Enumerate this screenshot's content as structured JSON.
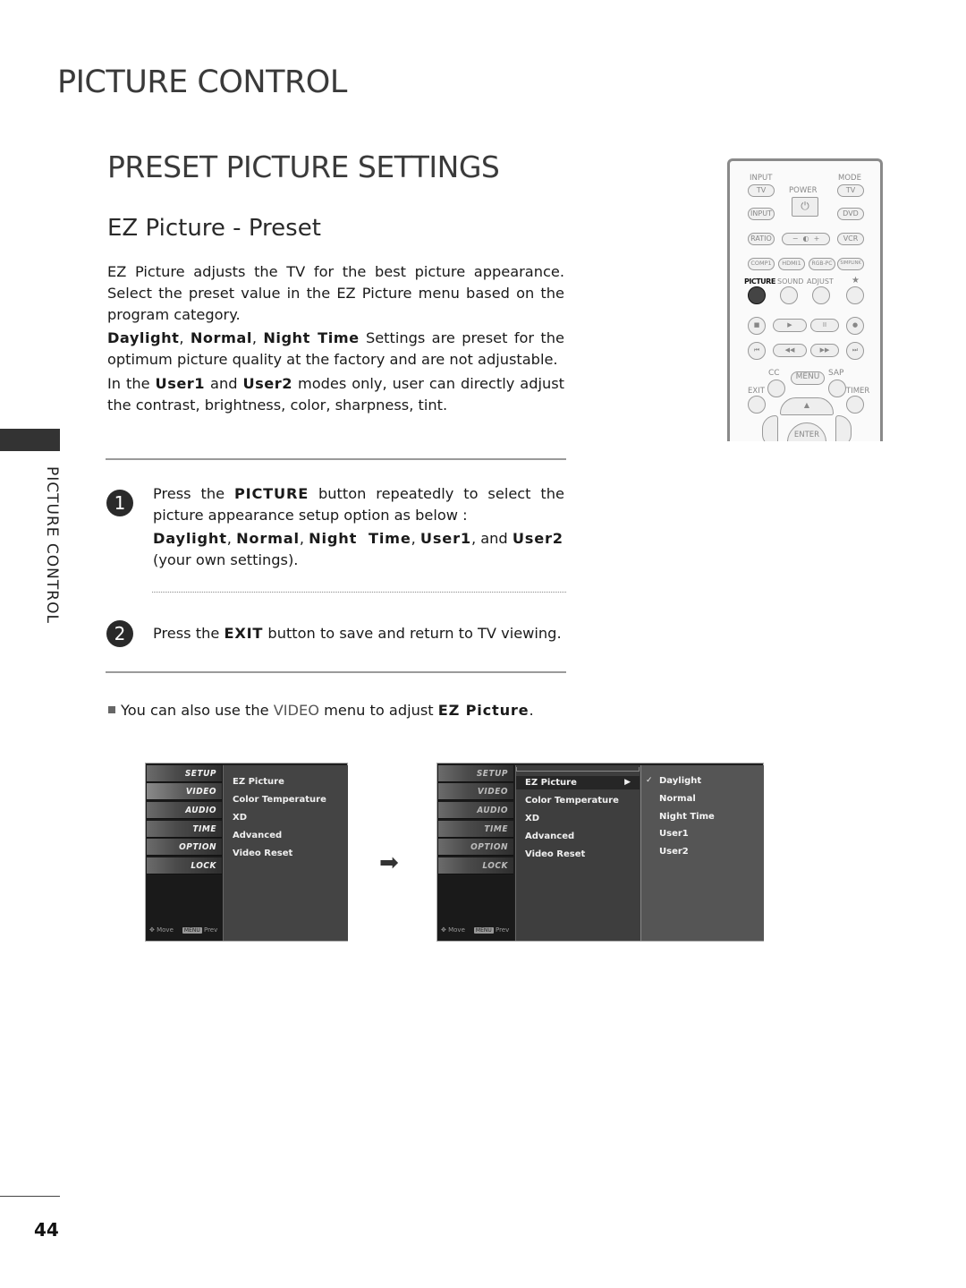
{
  "header": {
    "chapter_title": "PICTURE CONTROL",
    "section_title": "PRESET PICTURE SETTINGS",
    "sub_title": "EZ Picture - Preset"
  },
  "intro": {
    "p1": "EZ Picture adjusts the TV for the best picture appearance. Select the preset value in the EZ Picture menu based on the program category.",
    "p2_bold": [
      "Daylight",
      "Normal",
      "Night Time"
    ],
    "p2_rest": " Settings are preset for the optimum picture quality at the factory and are not adjustable.",
    "p3_a": "In the ",
    "p3_user1": "User1",
    "p3_b": " and ",
    "p3_user2": "User2",
    "p3_c": " modes only, user can directly adjust the contrast, brightness, color, sharpness, tint."
  },
  "steps": [
    {
      "number": "1",
      "text_a": "Press the ",
      "key": "PICTURE",
      "text_b": " button repeatedly to select the picture appearance setup option as below :",
      "options": [
        "Daylight",
        "Normal",
        "Night  Time",
        "User1",
        "User2"
      ],
      "options_and": "and",
      "options_tail": "(your own settings)."
    },
    {
      "number": "2",
      "text_a": "Press the ",
      "key": "EXIT",
      "text_b": " button to save and return to TV viewing."
    }
  ],
  "note": {
    "text_a": "You can also use the ",
    "menu": "VIDEO",
    "text_b": " menu to adjust ",
    "target": "EZ Picture",
    "text_c": "."
  },
  "side_tab": {
    "label": "PICTURE CONTROL"
  },
  "footer": {
    "page_number": "44"
  },
  "remote": {
    "labels": {
      "input": "INPUT",
      "mode": "MODE",
      "power": "POWER",
      "tv": "TV",
      "input_btn": "INPUT",
      "dvd": "DVD",
      "ratio": "RATIO",
      "vcr": "VCR",
      "comp1": "COMP1",
      "hdmi1": "HDMI1",
      "rgbpc": "RGB-PC",
      "simplink": "SIMPLINK",
      "picture": "PICTURE",
      "sound": "SOUND",
      "adjust": "ADJUST",
      "star": "★",
      "cc": "CC",
      "menu": "MENU",
      "sap": "SAP",
      "exit": "EXIT",
      "timer": "TIMER",
      "enter": "ENTER",
      "brightness_minus": "−",
      "brightness_plus": "+"
    },
    "highlighted_button": "PICTURE"
  },
  "osd_menu_1": {
    "tabs": [
      "SETUP",
      "VIDEO",
      "AUDIO",
      "TIME",
      "OPTION",
      "LOCK"
    ],
    "active_tab": "VIDEO",
    "items": [
      "EZ Picture",
      "Color Temperature",
      "XD",
      "Advanced",
      "Video Reset"
    ],
    "footer_move": "Move",
    "footer_menu_key": "MENU",
    "footer_prev": "Prev"
  },
  "osd_menu_2": {
    "tabs": [
      "SETUP",
      "VIDEO",
      "AUDIO",
      "TIME",
      "OPTION",
      "LOCK"
    ],
    "items": [
      "EZ Picture",
      "Color Temperature",
      "XD",
      "Advanced",
      "Video Reset"
    ],
    "selected_item": "EZ Picture",
    "submenu_arrow": "▶",
    "submenu": [
      "Daylight",
      "Normal",
      "Night Time",
      "User1",
      "User2"
    ],
    "checked_submenu": "Daylight",
    "check_mark": "✓",
    "footer_move": "Move",
    "footer_menu_key": "MENU",
    "footer_prev": "Prev"
  },
  "transition_arrow": "➡"
}
